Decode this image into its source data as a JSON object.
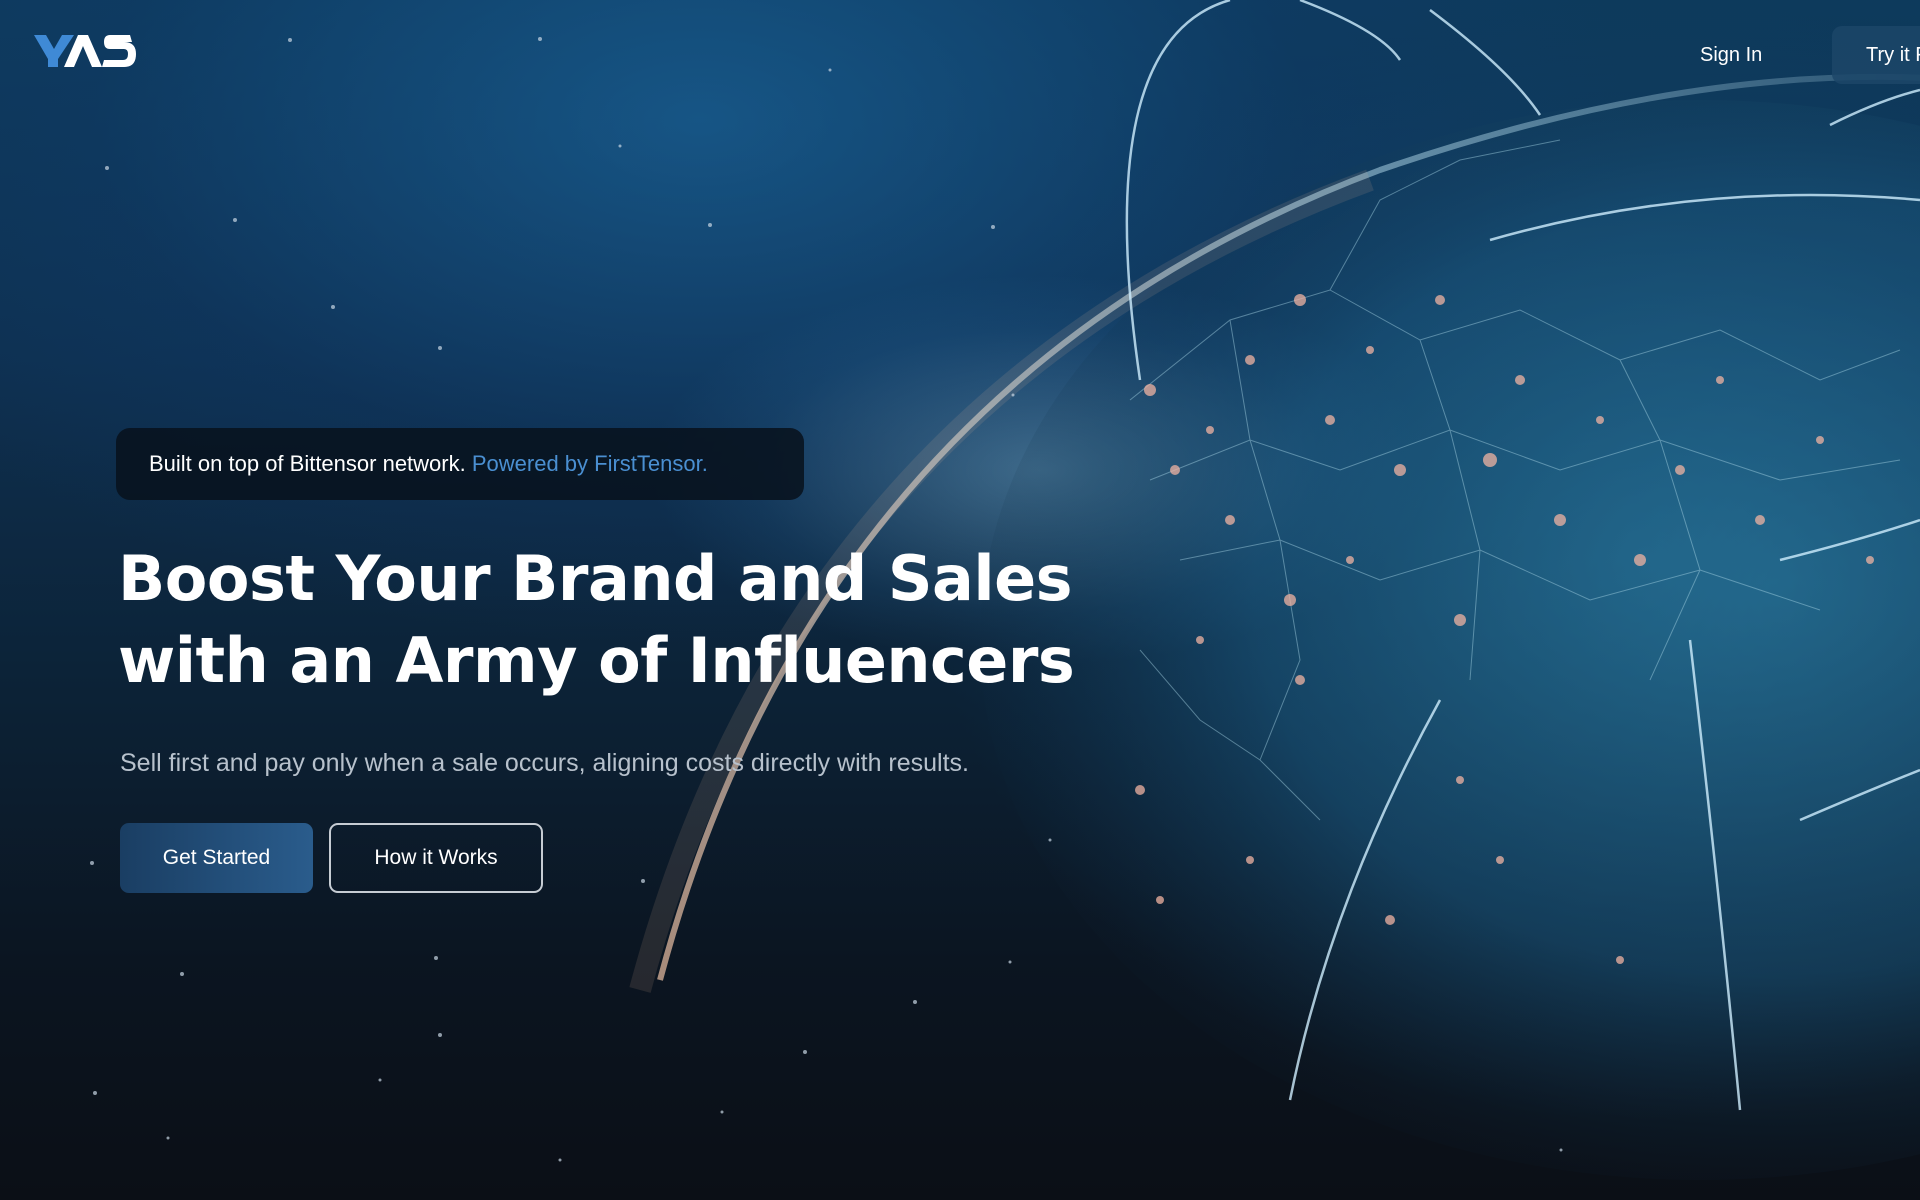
{
  "header": {
    "logo_text": "YADS",
    "sign_in_label": "Sign In",
    "try_label": "Try it Free"
  },
  "hero": {
    "banner_plain": "Built on top of Bittensor network.",
    "banner_link": "Powered by FirstTensor.",
    "headline_line1": "Boost Your Brand and Sales",
    "headline_line2": "with an Army of Influencers",
    "subtext": "Sell first and pay only when a sale occurs, aligning costs directly with results.",
    "primary_button": "Get Started",
    "secondary_button": "How it Works"
  },
  "colors": {
    "accent_link": "#4a8fd1",
    "primary_button": "#1f4a74",
    "background": "#0b0f16"
  },
  "icons": {
    "logo": "yads-logo",
    "background": "glowing-globe-network"
  }
}
